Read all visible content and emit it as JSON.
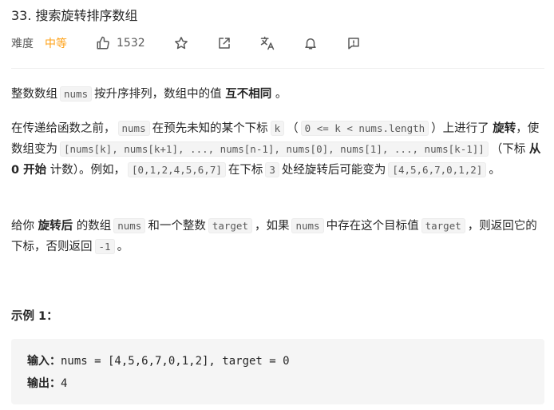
{
  "problem": {
    "title": "33. 搜索旋转排序数组",
    "difficulty_label": "难度",
    "difficulty_value": "中等",
    "likes": "1532"
  },
  "icons": [
    "thumbs-up-icon",
    "star-icon",
    "share-icon",
    "translate-icon",
    "bell-icon",
    "feedback-icon"
  ],
  "colors": {
    "difficulty_medium": "#ffa116",
    "code_bg": "#f4f4f4",
    "example_bg": "#f5f5f5"
  },
  "description": {
    "p1": {
      "t1": "整数数组",
      "code1": "nums",
      "t2": "按升序排列，数组中的值",
      "bold1": "互不相同",
      "t3": "。"
    },
    "p2": {
      "t1": "在传递给函数之前，",
      "code1": "nums",
      "t2": "在预先未知的某个下标",
      "code2": "k",
      "t3": "（",
      "code3": "0 <= k < nums.length",
      "t4": "）上进行了",
      "bold1": "旋转",
      "t5": "，使数组变为",
      "code4": "[nums[k], nums[k+1], ..., nums[n-1], nums[0], nums[1], ..., nums[k-1]]",
      "t6": "（下标",
      "bold2": "从 0 开始",
      "t7": "计数）。例如，",
      "code5": "[0,1,2,4,5,6,7]",
      "t8": "在下标",
      "code6": "3",
      "t9": "处经旋转后可能变为",
      "code7": "[4,5,6,7,0,1,2]",
      "t10": "。"
    },
    "p3": {
      "t1": "给你",
      "bold1": "旋转后",
      "t2": "的数组",
      "code1": "nums",
      "t3": "和一个整数",
      "code2": "target",
      "t4": "，如果",
      "code3": "nums",
      "t5": "中存在这个目标值",
      "code4": "target",
      "t6": "，则返回它的下标，否则返回",
      "code5": "-1",
      "t7": "。"
    }
  },
  "example": {
    "title": "示例 1：",
    "input_label": "输入：",
    "input_value": "nums = [4,5,6,7,0,1,2], target = 0",
    "output_label": "输出：",
    "output_value": "4"
  }
}
